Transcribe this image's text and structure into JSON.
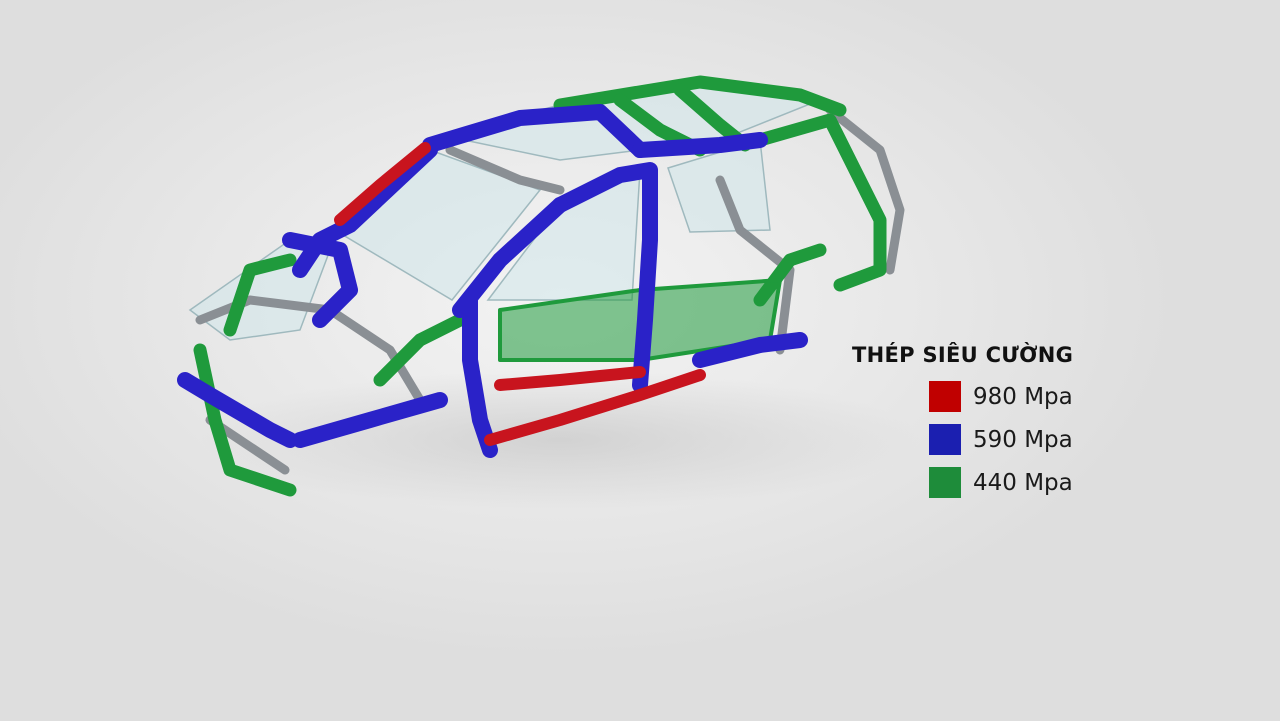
{
  "legend": {
    "title": "THÉP SIÊU CƯỜNG",
    "items": [
      {
        "label": "980 Mpa",
        "color": "#c00000"
      },
      {
        "label": "590 Mpa",
        "color": "#1b1fb0"
      },
      {
        "label": "440 Mpa",
        "color": "#1e8c3a"
      }
    ]
  },
  "illustration": {
    "colors": {
      "high": "#c8141e",
      "mid": "#2a22c8",
      "low": "#1f9a3c",
      "gray": "#8a8f94",
      "glass": "#cfe6ea"
    }
  }
}
